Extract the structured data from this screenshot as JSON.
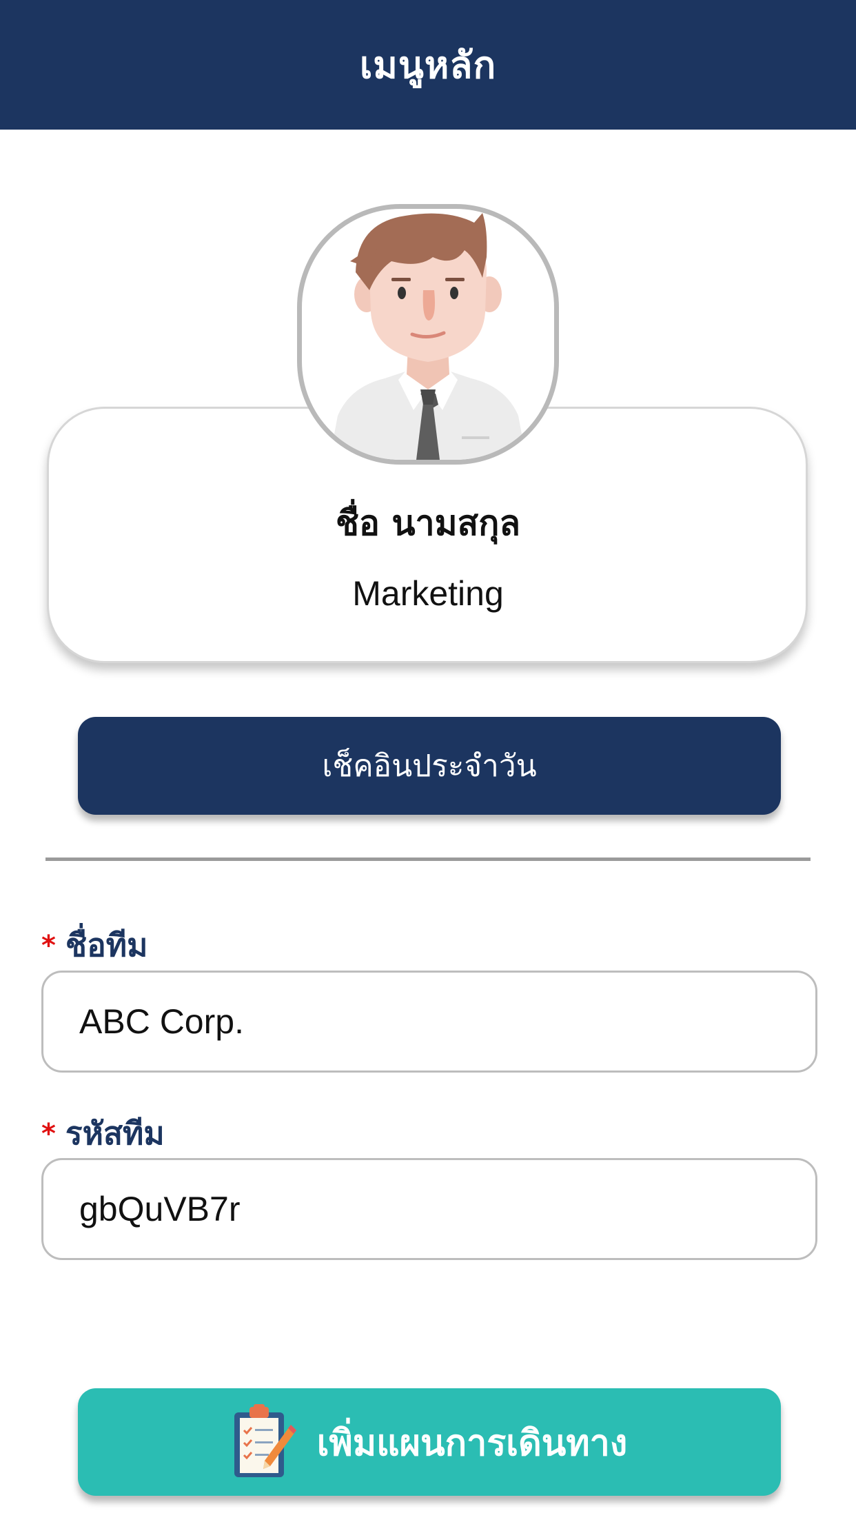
{
  "header": {
    "title": "เมนูหลัก"
  },
  "profile": {
    "name": "ชื่อ นามสกุล",
    "department": "Marketing",
    "avatar_icon": "user-avatar-icon"
  },
  "checkin": {
    "label": "เช็คอินประจำวัน"
  },
  "form": {
    "required_mark": "*",
    "team_name": {
      "label": "ชื่อทีม",
      "value": "ABC Corp."
    },
    "team_code": {
      "label": "รหัสทีม",
      "value": "gbQuVB7r"
    }
  },
  "add_plan": {
    "label": "เพิ่มแผนการเดินทาง",
    "icon": "clipboard-checklist-icon"
  },
  "colors": {
    "header_bg": "#1c3560",
    "accent_teal": "#2bbdb3",
    "required_red": "#e01010"
  }
}
